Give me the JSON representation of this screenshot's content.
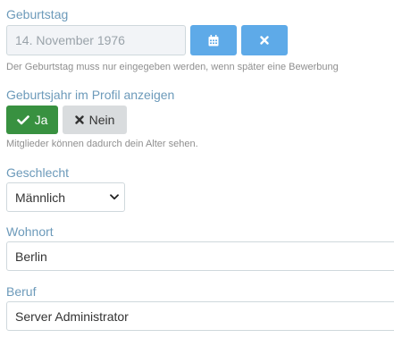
{
  "birthday": {
    "label": "Geburtstag",
    "value": "14. November 1976",
    "hint": "Der Geburtstag muss nur eingegeben werden, wenn später eine Bewerbung",
    "calendar_icon": "calendar-icon",
    "clear_icon": "close-icon"
  },
  "birthyear_visibility": {
    "label": "Geburtsjahr im Profil anzeigen",
    "yes_label": "Ja",
    "no_label": "Nein",
    "selected": "Ja",
    "hint": "Mitglieder können dadurch dein Alter sehen."
  },
  "gender": {
    "label": "Geschlecht",
    "selected": "Männlich"
  },
  "city": {
    "label": "Wohnort",
    "value": "Berlin"
  },
  "occupation": {
    "label": "Beruf",
    "value": "Server Administrator"
  },
  "colors": {
    "label": "#6c9aba",
    "icon_button": "#5eaae8",
    "yes_active": "#389140",
    "no_inactive": "#d9dcde"
  }
}
